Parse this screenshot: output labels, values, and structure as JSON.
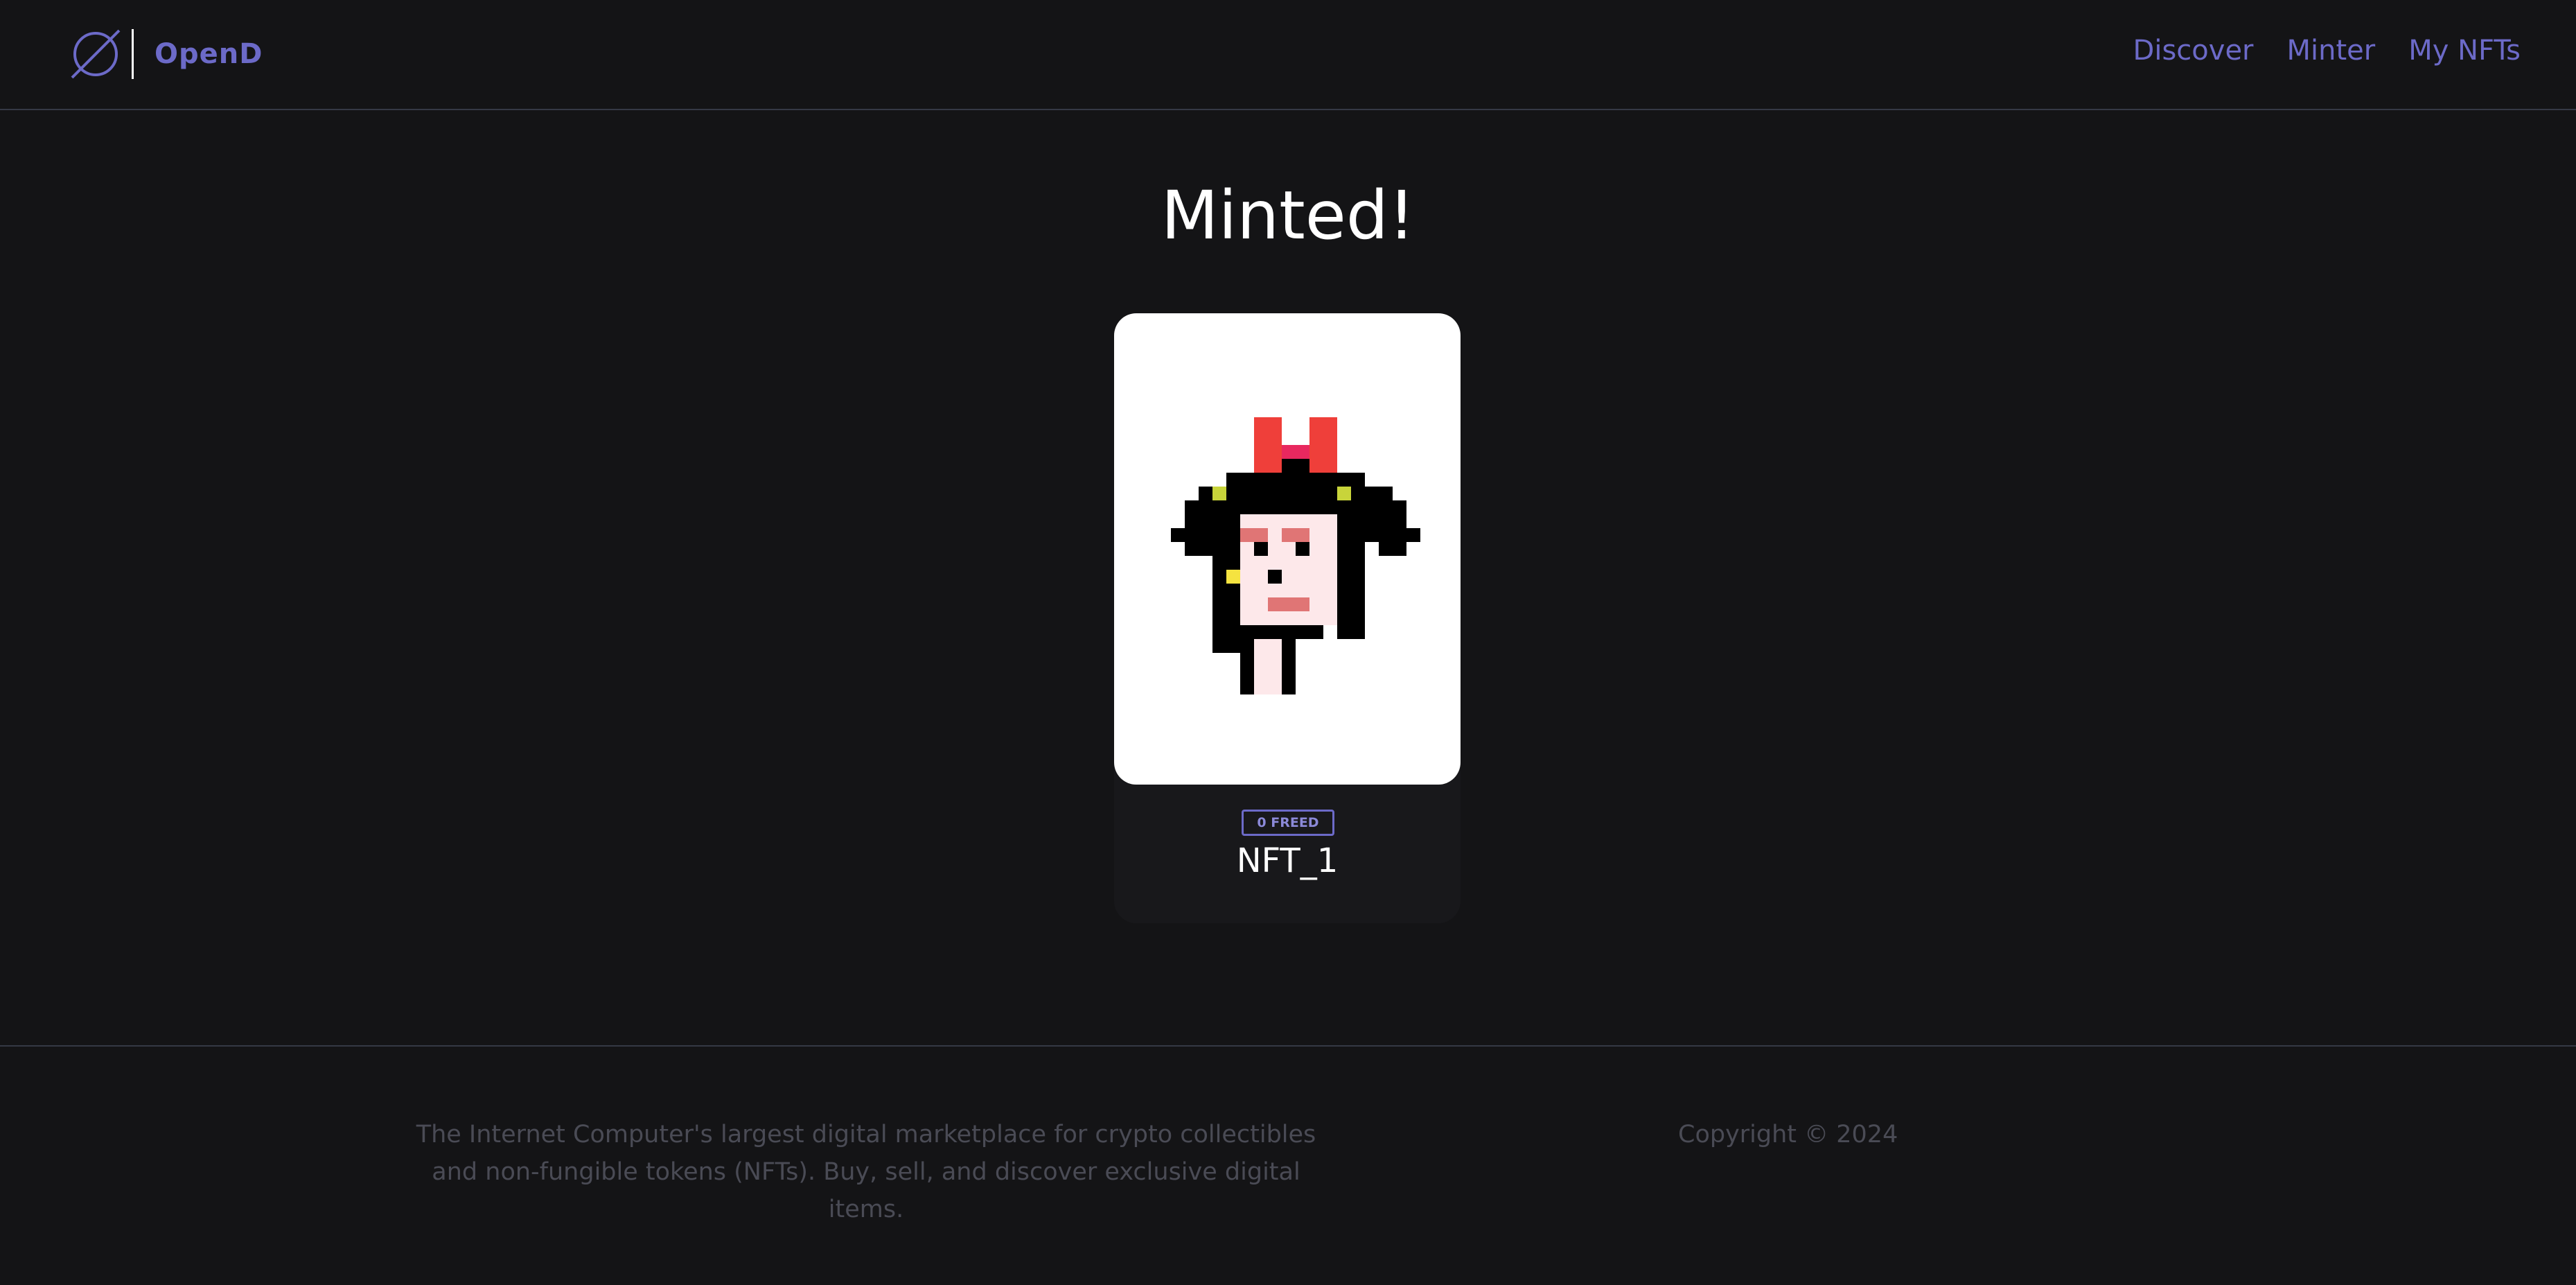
{
  "header": {
    "logo_icon": "planet-icon",
    "brand": "OpenD",
    "nav": [
      {
        "label": "Discover"
      },
      {
        "label": "Minter"
      },
      {
        "label": "My NFTs"
      }
    ]
  },
  "main": {
    "title": "Minted!",
    "nft": {
      "badge": "0 FREED",
      "name": "NFT_1",
      "image": "pixel-punk-avatar"
    }
  },
  "footer": {
    "description": "The Internet Computer's largest digital marketplace for crypto collectibles and non-fungible tokens (NFTs). Buy, sell, and discover exclusive digital items.",
    "copyright": "Copyright © 2024"
  },
  "colors": {
    "background": "#141416",
    "accent": "#6c6ac8",
    "muted_text": "#4a4b55",
    "divider": "#353945"
  }
}
